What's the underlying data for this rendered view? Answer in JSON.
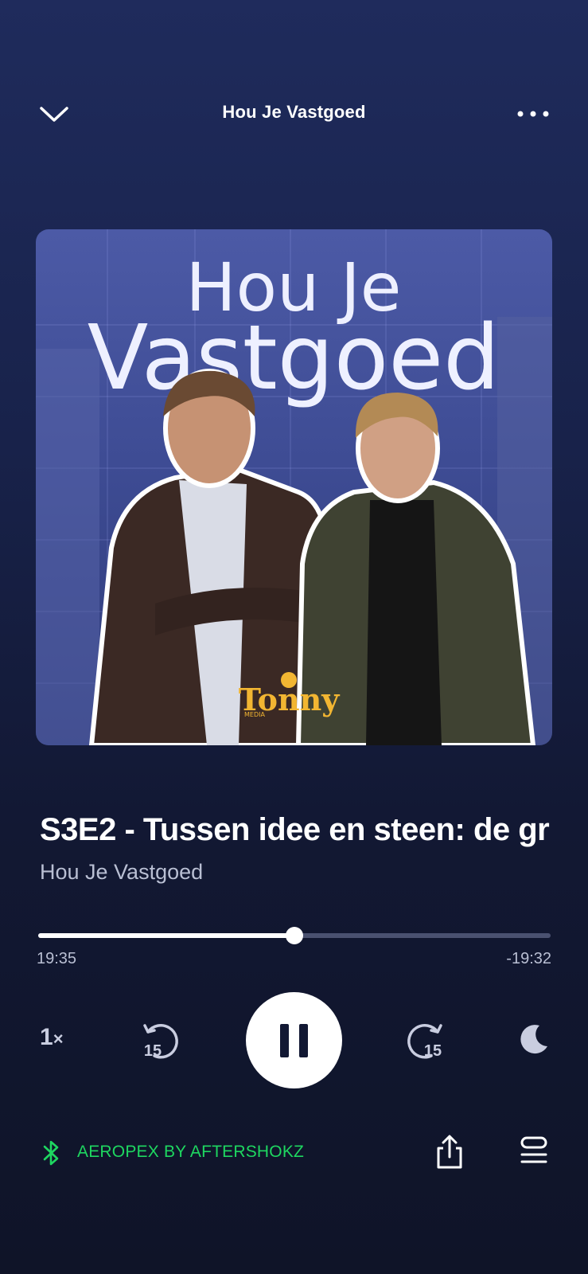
{
  "header": {
    "title": "Hou Je Vastgoed",
    "collapse_icon": "chevron-down-icon",
    "more_icon": "more-horizontal-icon"
  },
  "artwork": {
    "title_line1": "Hou Je",
    "title_line2": "Vastgoed",
    "publisher_logo_text": "Tonny",
    "publisher_logo_sub": "MEDIA"
  },
  "episode": {
    "title": "S3E2 - Tussen idee en steen: de gr",
    "show": "Hou Je Vastgoed"
  },
  "progress": {
    "elapsed": "19:35",
    "remaining": "-19:32",
    "fraction": 0.5
  },
  "controls": {
    "speed_value": "1",
    "speed_suffix": "×",
    "skip_back_seconds": "15",
    "skip_forward_seconds": "15",
    "play_state_icon": "pause-icon",
    "sleep_icon": "moon-icon"
  },
  "footer": {
    "device_icon": "bluetooth-icon",
    "device_name": "AEROPEX BY AFTERSHOKZ",
    "share_icon": "share-icon",
    "queue_icon": "queue-icon"
  },
  "colors": {
    "accent_green": "#1ed760",
    "background_top": "#1f2b5c",
    "background_bottom": "#0f1428"
  }
}
